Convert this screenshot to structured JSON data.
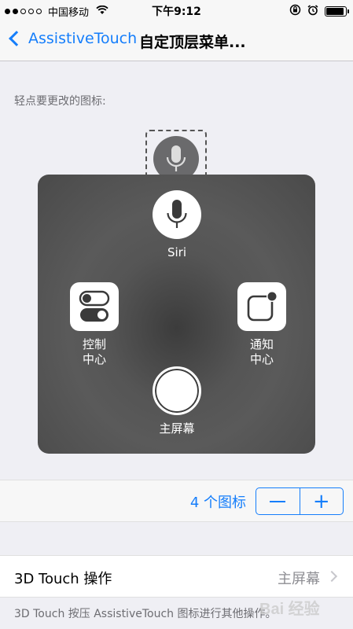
{
  "status_bar": {
    "carrier": "中国移动",
    "time": "下午9:12",
    "battery_level": 0.9
  },
  "nav": {
    "back_label": "AssistiveTouch",
    "title": "自定顶层菜单..."
  },
  "section_label": "轻点要更改的图标:",
  "menu": {
    "items": [
      {
        "icon": "siri-microphone-icon",
        "label_line1": "Siri",
        "label_line2": ""
      },
      {
        "icon": "control-center-toggles-icon",
        "label_line1": "控制",
        "label_line2": "中心"
      },
      {
        "icon": "notification-center-icon",
        "label_line1": "通知",
        "label_line2": "中心"
      },
      {
        "icon": "home-button-icon",
        "label_line1": "主屏幕",
        "label_line2": ""
      }
    ]
  },
  "icon_count": {
    "text": "4 个图标",
    "minus_label": "−",
    "plus_label": "+"
  },
  "touch_row": {
    "label": "3D Touch 操作",
    "value": "主屏幕"
  },
  "footer_note": "3D Touch 按压 AssistiveTouch 图标进行其他操作。",
  "watermark": "Bai 经验",
  "colors": {
    "accent": "#157efb",
    "background": "#efeff4",
    "menu_panel": "#555555"
  }
}
